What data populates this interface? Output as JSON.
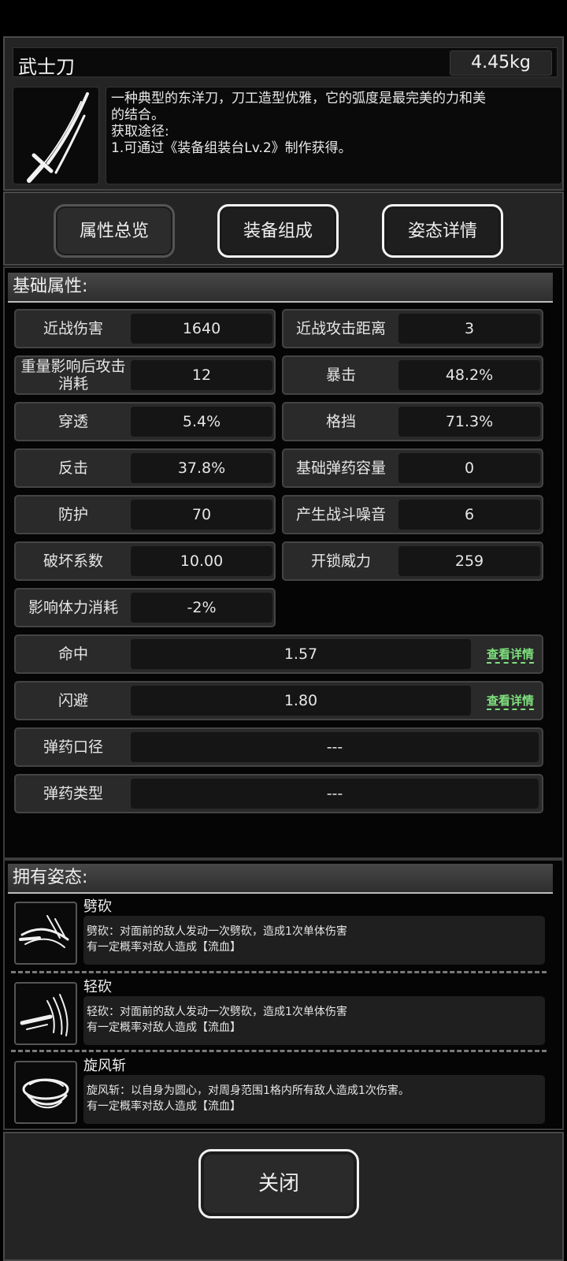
{
  "item": {
    "name": "武士刀",
    "weight": "4.45kg",
    "icon": "katana-icon",
    "description_lines": [
      "一种典型的东洋刀，刀工造型优雅，它的弧度是最完美的力和美",
      "的结合。",
      "获取途径:",
      "1.可通过《装备组装台Lv.2》制作获得。"
    ]
  },
  "tabs": [
    "属性总览",
    "装备组成",
    "姿态详情"
  ],
  "attributes": {
    "title": "基础属性:",
    "pairs": [
      {
        "label": "近战伤害",
        "value": "1640"
      },
      {
        "label": "近战攻击距离",
        "value": "3"
      },
      {
        "label": "重量影响后攻击消耗",
        "value": "12"
      },
      {
        "label": "暴击",
        "value": "48.2%"
      },
      {
        "label": "穿透",
        "value": "5.4%"
      },
      {
        "label": "格挡",
        "value": "71.3%"
      },
      {
        "label": "反击",
        "value": "37.8%"
      },
      {
        "label": "基础弹药容量",
        "value": "0"
      },
      {
        "label": "防护",
        "value": "70"
      },
      {
        "label": "产生战斗噪音",
        "value": "6"
      },
      {
        "label": "破坏系数",
        "value": "10.00"
      },
      {
        "label": "开锁威力",
        "value": "259"
      },
      {
        "label": "影响体力消耗",
        "value": "-2%"
      }
    ],
    "wide": [
      {
        "label": "命中",
        "value": "1.57",
        "link": "查看详情"
      },
      {
        "label": "闪避",
        "value": "1.80",
        "link": "查看详情"
      },
      {
        "label": "弹药口径",
        "value": "---"
      },
      {
        "label": "弹药类型",
        "value": "---"
      }
    ]
  },
  "stances": {
    "title": "拥有姿态:",
    "items": [
      {
        "name": "劈砍",
        "icon": "heavy-slash-icon",
        "line1": "劈砍：对面前的敌人发动一次劈砍，造成1次单体伤害",
        "line2": "有一定概率对敌人造成【流血】"
      },
      {
        "name": "轻砍",
        "icon": "light-slash-icon",
        "line1": "轻砍：对面前的敌人发动一次劈砍，造成1次单体伤害",
        "line2": "有一定概率对敌人造成【流血】"
      },
      {
        "name": "旋风斩",
        "icon": "whirlwind-slash-icon",
        "line1": "旋风斩：以自身为圆心，对周身范围1格内所有敌人造成1次伤害。",
        "line2": "有一定概率对敌人造成【流血】"
      }
    ]
  },
  "footer": {
    "close_label": "关闭"
  }
}
